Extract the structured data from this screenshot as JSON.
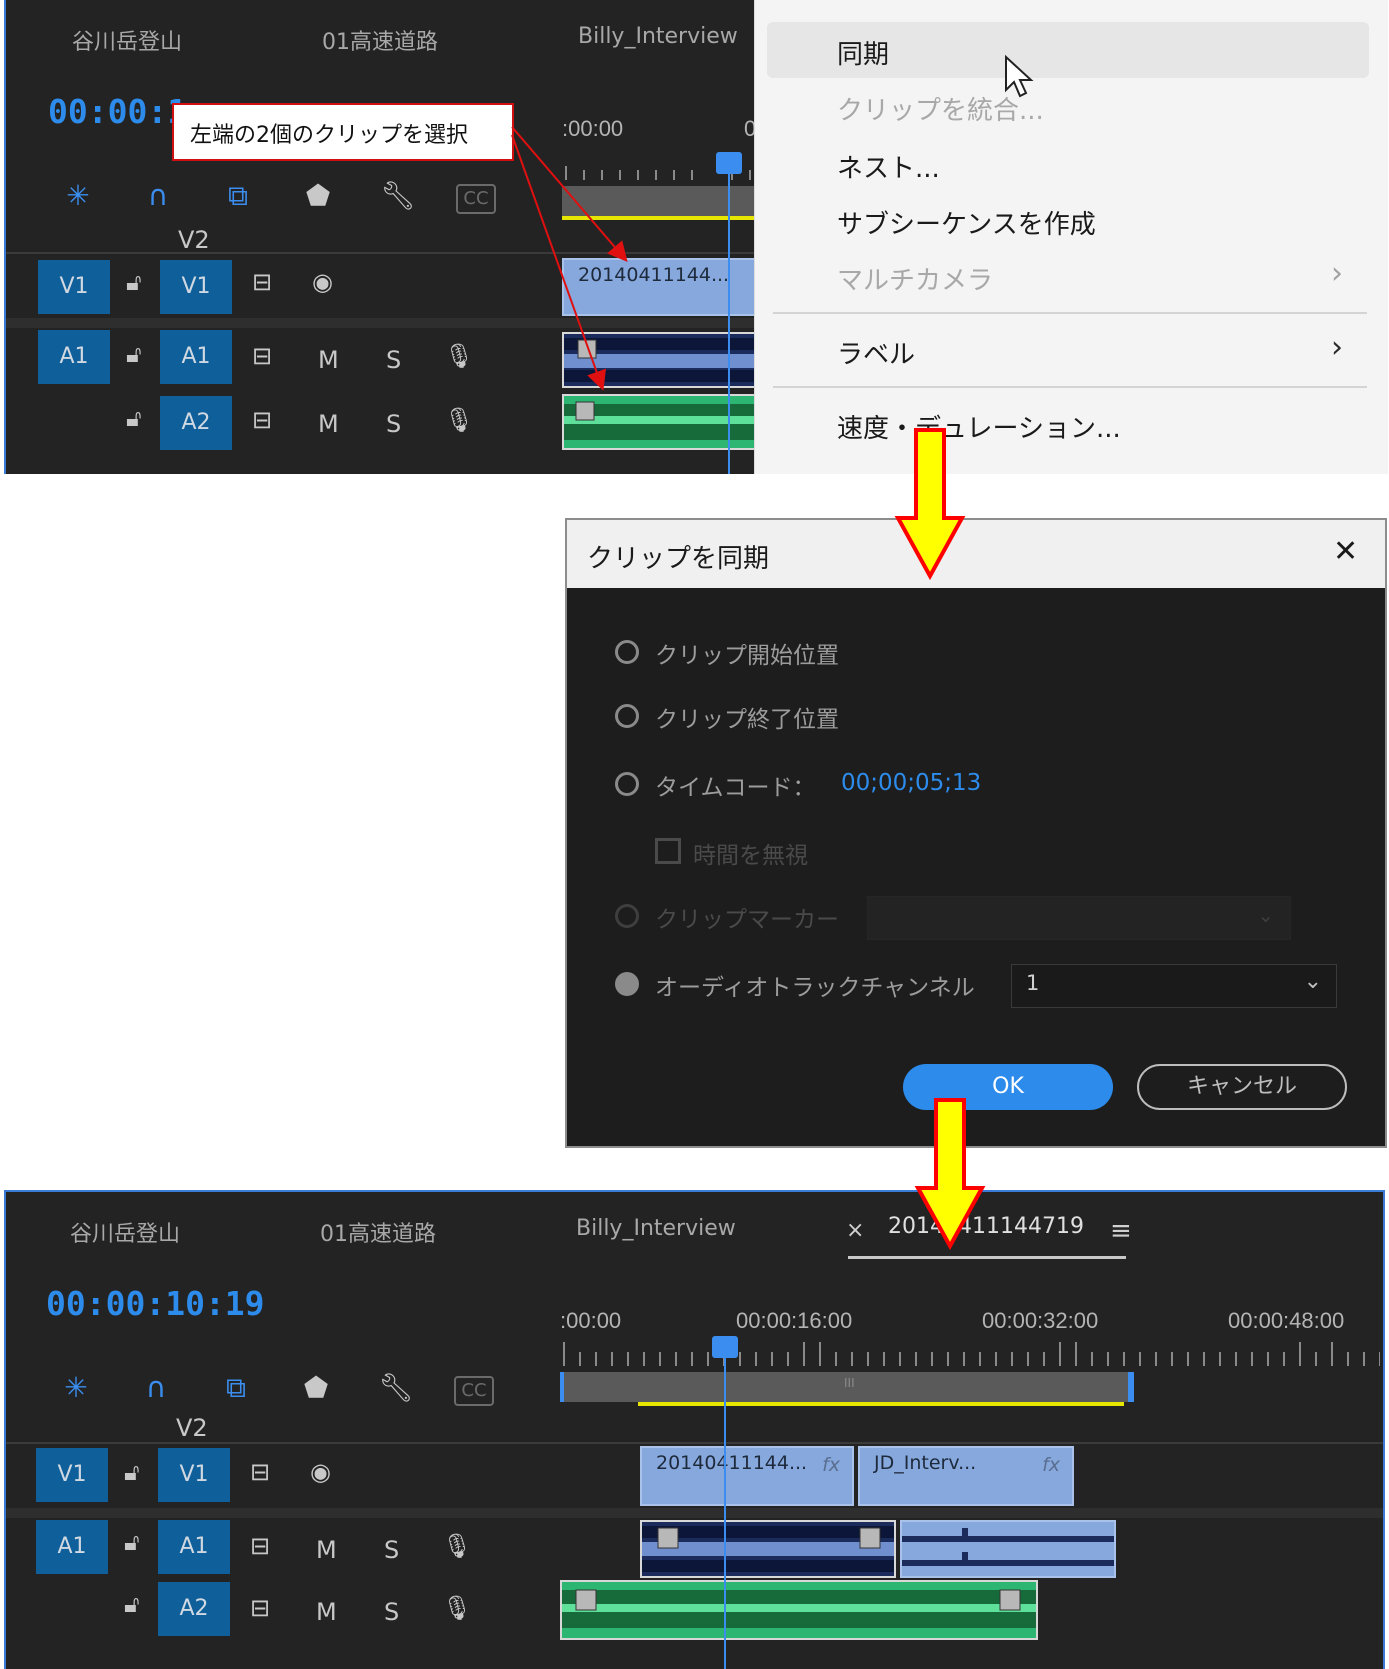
{
  "top_panel": {
    "tabs": [
      "谷川岳登山",
      "01高速道路",
      "Billy_Interview"
    ],
    "timecode": "00:00:1",
    "ruler_labels": [
      ":00:00",
      "0"
    ],
    "tracks": {
      "v2": "V2",
      "v1_src": "V1",
      "v1_tgt": "V1",
      "a1_src": "A1",
      "a1_tgt": "A1",
      "a2_tgt": "A2",
      "mute": "M",
      "solo": "S"
    },
    "clip_v1_label": "20140411144..."
  },
  "callout": {
    "text": "左端の2個のクリップを選択"
  },
  "context_menu": {
    "items": [
      {
        "label": "同期",
        "disabled": false
      },
      {
        "label": "クリップを統合...",
        "disabled": true
      },
      {
        "label": "ネスト...",
        "disabled": false
      },
      {
        "label": "サブシーケンスを作成",
        "disabled": false
      },
      {
        "label": "マルチカメラ",
        "disabled": true
      },
      {
        "label": "ラベル",
        "disabled": false
      },
      {
        "label": "速度・デュレーション...",
        "disabled": false
      }
    ],
    "submenu_glyph": "›"
  },
  "dialog": {
    "title": "クリップを同期",
    "close_glyph": "✕",
    "options": {
      "clip_start": "クリップ開始位置",
      "clip_end": "クリップ終了位置",
      "timecode": "タイムコード：",
      "timecode_value": "00;00;05;13",
      "ignore_hours": "時間を無視",
      "clip_marker": "クリップマーカー",
      "audio_channel": "オーディオトラックチャンネル",
      "audio_channel_value": "1"
    },
    "ok": "OK",
    "cancel": "キャンセル"
  },
  "bottom_panel": {
    "tabs": [
      "谷川岳登山",
      "01高速道路",
      "Billy_Interview"
    ],
    "active_tab": "20140411144719",
    "active_tab_close": "×",
    "active_tab_menu": "≡",
    "timecode": "00:00:10:19",
    "ruler_labels": [
      ":00:00",
      "00:00:16:00",
      "00:00:32:00",
      "00:00:48:00"
    ],
    "tracks": {
      "v2": "V2",
      "v1_src": "V1",
      "v1_tgt": "V1",
      "a1_src": "A1",
      "a1_tgt": "A1",
      "a2_tgt": "A2",
      "mute": "M",
      "solo": "S"
    },
    "clip_v1_a": "20140411144...",
    "clip_v1_b": "JD_Interv...",
    "fx": "fx",
    "scroll_grip": "III"
  },
  "colors": {
    "panel_bg": "#232323",
    "timecode_blue": "#2d8ceb",
    "track_target": "#0f5f9a",
    "video_clip": "#86a8dc",
    "audio_clip_a1": "#1b2b5c",
    "audio_clip_a2": "#2db572",
    "work_area": "#e6e600",
    "arrow_fill": "#ffff00",
    "arrow_stroke": "#ff0000"
  }
}
